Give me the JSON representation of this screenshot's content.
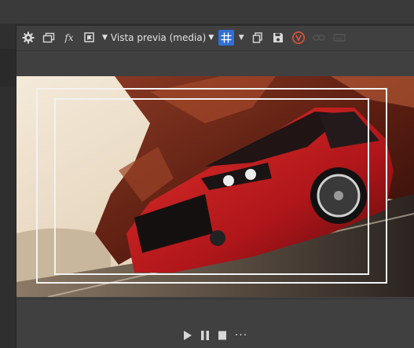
{
  "toolbar": {
    "icons": [
      "gear-icon",
      "duplicate-window-icon",
      "fx-icon",
      "flag-icon",
      "dropdown-caret-icon",
      "grid-icon",
      "copy-icon",
      "save-icon",
      "v-badge-icon",
      "link-icon",
      "keyboard-icon"
    ],
    "fx_label": "fx",
    "preview_mode": "Vista previa (media)",
    "accent": "#2f6fd6",
    "badge_color": "#e0533d"
  },
  "transport": {
    "icons": [
      "play-icon",
      "pause-icon",
      "stop-icon"
    ],
    "more_label": "···"
  }
}
